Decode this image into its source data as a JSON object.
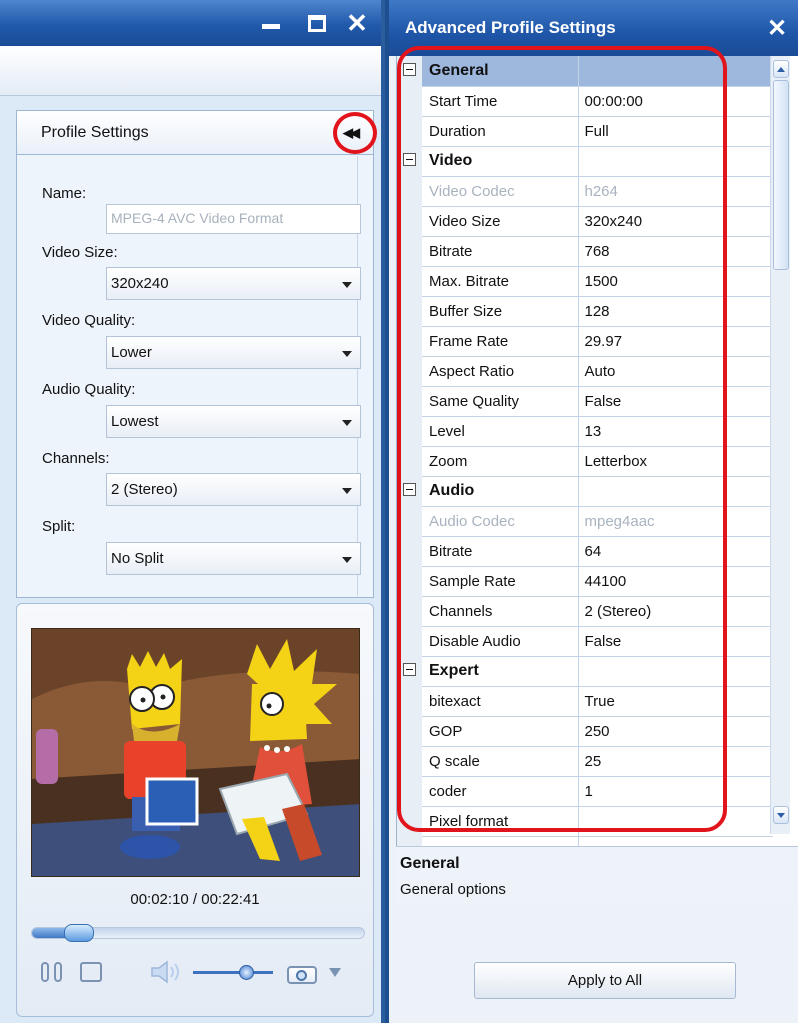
{
  "left_window": {
    "controls": {
      "minimize": "minimize",
      "maximize": "maximize",
      "close": "✕"
    },
    "profile_panel": {
      "header": "Profile Settings",
      "collapse_glyph": "◀◀",
      "name_label": "Name:",
      "name_value": "MPEG-4 AVC Video Format",
      "fields": [
        {
          "label": "Video Size:",
          "value": "320x240"
        },
        {
          "label": "Video Quality:",
          "value": "Lower"
        },
        {
          "label": "Audio Quality:",
          "value": "Lowest"
        },
        {
          "label": "Channels:",
          "value": "2 (Stereo)"
        },
        {
          "label": "Split:",
          "value": "No Split"
        }
      ]
    },
    "preview": {
      "timecode": "00:02:10 / 00:22:41",
      "position_fraction": 0.096,
      "volume_fraction": 0.68,
      "icons": [
        "pause-icon",
        "stop-icon",
        "volume-icon",
        "volume-slider",
        "camera-snapshot-icon",
        "dropdown-arrow-icon"
      ]
    }
  },
  "right_window": {
    "title": "Advanced Profile Settings",
    "close": "✕",
    "grid": [
      {
        "type": "category",
        "name": "General"
      },
      {
        "type": "prop",
        "name": "Start Time",
        "value": "00:00:00"
      },
      {
        "type": "prop",
        "name": "Duration",
        "value": "Full"
      },
      {
        "type": "category",
        "name": "Video"
      },
      {
        "type": "prop",
        "name": "Video Codec",
        "value": "h264",
        "readonly": true
      },
      {
        "type": "prop",
        "name": "Video Size",
        "value": "320x240"
      },
      {
        "type": "prop",
        "name": "Bitrate",
        "value": "768"
      },
      {
        "type": "prop",
        "name": "Max. Bitrate",
        "value": "1500"
      },
      {
        "type": "prop",
        "name": "Buffer Size",
        "value": "128"
      },
      {
        "type": "prop",
        "name": "Frame Rate",
        "value": "29.97"
      },
      {
        "type": "prop",
        "name": "Aspect Ratio",
        "value": "Auto"
      },
      {
        "type": "prop",
        "name": "Same Quality",
        "value": "False"
      },
      {
        "type": "prop",
        "name": "Level",
        "value": "13"
      },
      {
        "type": "prop",
        "name": "Zoom",
        "value": "Letterbox"
      },
      {
        "type": "category",
        "name": "Audio"
      },
      {
        "type": "prop",
        "name": "Audio Codec",
        "value": "mpeg4aac",
        "readonly": true
      },
      {
        "type": "prop",
        "name": "Bitrate",
        "value": "64"
      },
      {
        "type": "prop",
        "name": "Sample Rate",
        "value": "44100"
      },
      {
        "type": "prop",
        "name": "Channels",
        "value": "2 (Stereo)"
      },
      {
        "type": "prop",
        "name": "Disable Audio",
        "value": "False"
      },
      {
        "type": "category",
        "name": "Expert"
      },
      {
        "type": "prop",
        "name": "bitexact",
        "value": "True"
      },
      {
        "type": "prop",
        "name": "GOP",
        "value": "250"
      },
      {
        "type": "prop",
        "name": "Q scale",
        "value": "25"
      },
      {
        "type": "prop",
        "name": "coder",
        "value": "1"
      },
      {
        "type": "prop",
        "name": "Pixel format",
        "value": ""
      }
    ],
    "description": {
      "title": "General",
      "text": "General options"
    },
    "apply_button": "Apply to All"
  },
  "colors": {
    "titlebar": "#2159ab",
    "highlight_ring": "#e2141b",
    "selected_category": "#9db7dd"
  }
}
